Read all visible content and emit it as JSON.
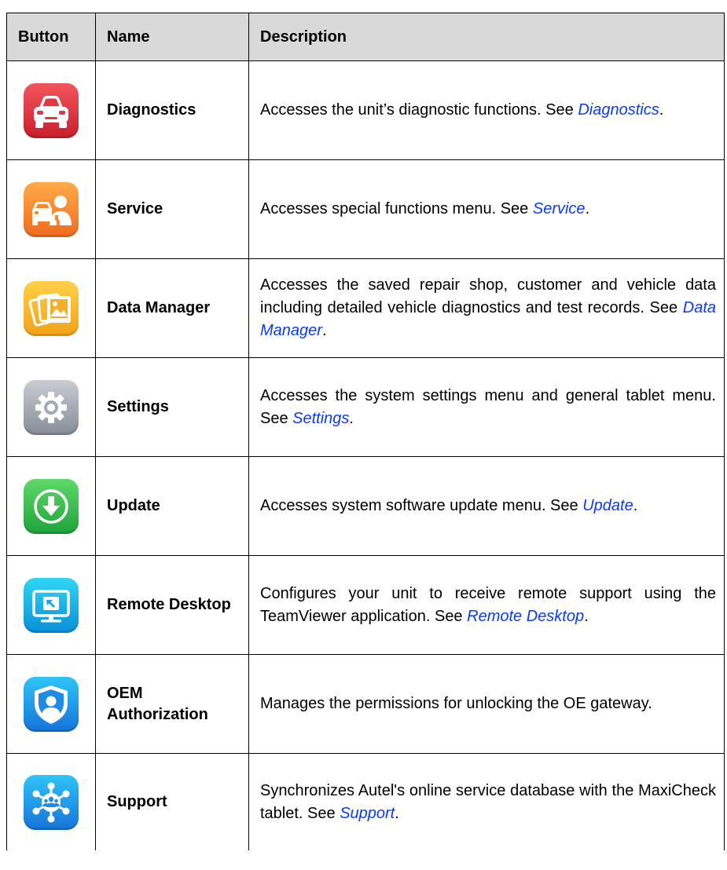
{
  "headers": {
    "button": "Button",
    "name": "Name",
    "description": "Description"
  },
  "rows": [
    {
      "icon": "car-icon",
      "name": "Diagnostics",
      "desc": "Accesses the unit’s diagnostic functions. See ",
      "link": "Diagnostics"
    },
    {
      "icon": "car-service-technician-icon",
      "name": "Service",
      "desc": "Accesses special functions menu. See ",
      "link": "Service"
    },
    {
      "icon": "photo-files-icon",
      "name": "Data Manager",
      "desc": "Accesses the saved repair shop, customer and vehicle data including detailed vehicle diagnostics and test records. See ",
      "link": "Data Manager"
    },
    {
      "icon": "gear-icon",
      "name": "Settings",
      "desc": "Accesses the system settings menu and general tablet menu. See ",
      "link": "Settings"
    },
    {
      "icon": "download-arrow-icon",
      "name": "Update",
      "desc": "Accesses system software update menu. See ",
      "link": "Update"
    },
    {
      "icon": "remote-desktop-monitor-icon",
      "name": "Remote Desktop",
      "desc": "Configures your unit to receive remote support using the TeamViewer application. See ",
      "link": "Remote Desktop"
    },
    {
      "icon": "shield-user-icon",
      "name": "OEM Authorization",
      "desc": "Manages the permissions for unlocking the OE gateway.",
      "link": ""
    },
    {
      "icon": "network-support-icon",
      "name": "Support",
      "desc": "Synchronizes Autel's online service database with the MaxiCheck tablet. See ",
      "link": "Support"
    }
  ],
  "period": "."
}
